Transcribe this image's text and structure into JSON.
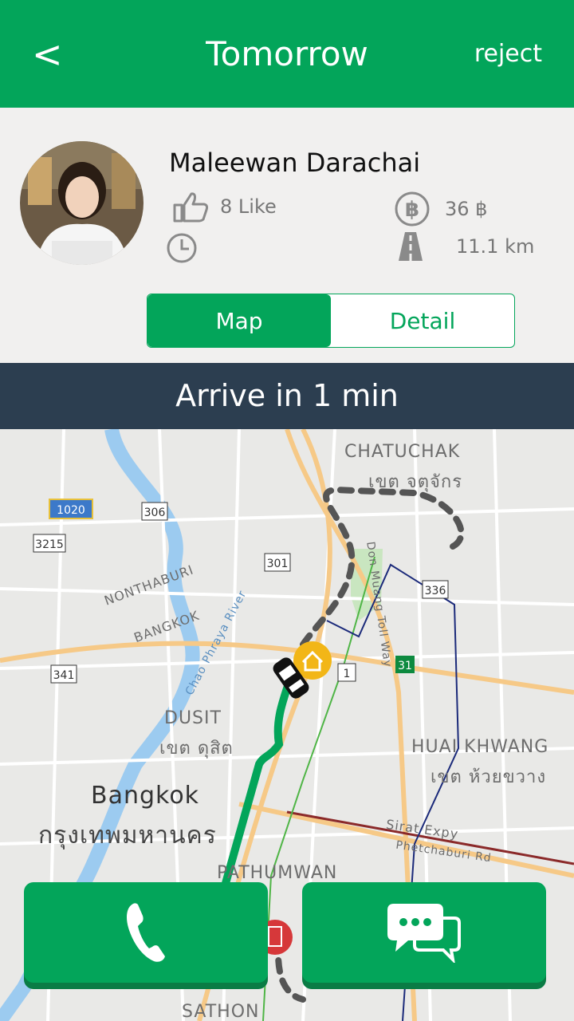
{
  "header": {
    "back_label": "<",
    "title": "Tomorrow",
    "reject_label": "reject"
  },
  "profile": {
    "name": "Maleewan Darachai",
    "likes": "8 Like",
    "price": "36 ฿",
    "distance": "11.1 km",
    "time": ""
  },
  "tabs": [
    {
      "label": "Map",
      "active": true
    },
    {
      "label": "Detail",
      "active": false
    }
  ],
  "banner": {
    "text": "Arrive in 1 min"
  },
  "map": {
    "labels": {
      "chatuchak": "CHATUCHAK",
      "chatuchak_th": "เขต จตุจักร",
      "nonthaburi": "NONTHABURI",
      "bangkok_small": "BANGKOK",
      "river": "Chao Phraya River",
      "dusit": "DUSIT",
      "dusit_th": "เขต ดุสิต",
      "huai_khwang": "HUAI KHWANG",
      "huai_khwang_th": "เขต ห้วยขวาง",
      "bangkok": "Bangkok",
      "bangkok_th": "กรุงเทพมหานคร",
      "pathumwan": "PATHUMWAN",
      "sathon": "SATHON",
      "tollway": "Don Muang Toll Way",
      "sirat": "Sirat Expy",
      "phetchaburi": "Phetchaburi Rd",
      "road_1020": "1020",
      "road_306": "306",
      "road_3215": "3215",
      "road_301": "301",
      "road_336": "336",
      "road_341": "341",
      "road_1": "1",
      "road_31": "31"
    }
  },
  "colors": {
    "primary": "#03a55a",
    "banner": "#2c3e50",
    "route": "#03a55a"
  }
}
